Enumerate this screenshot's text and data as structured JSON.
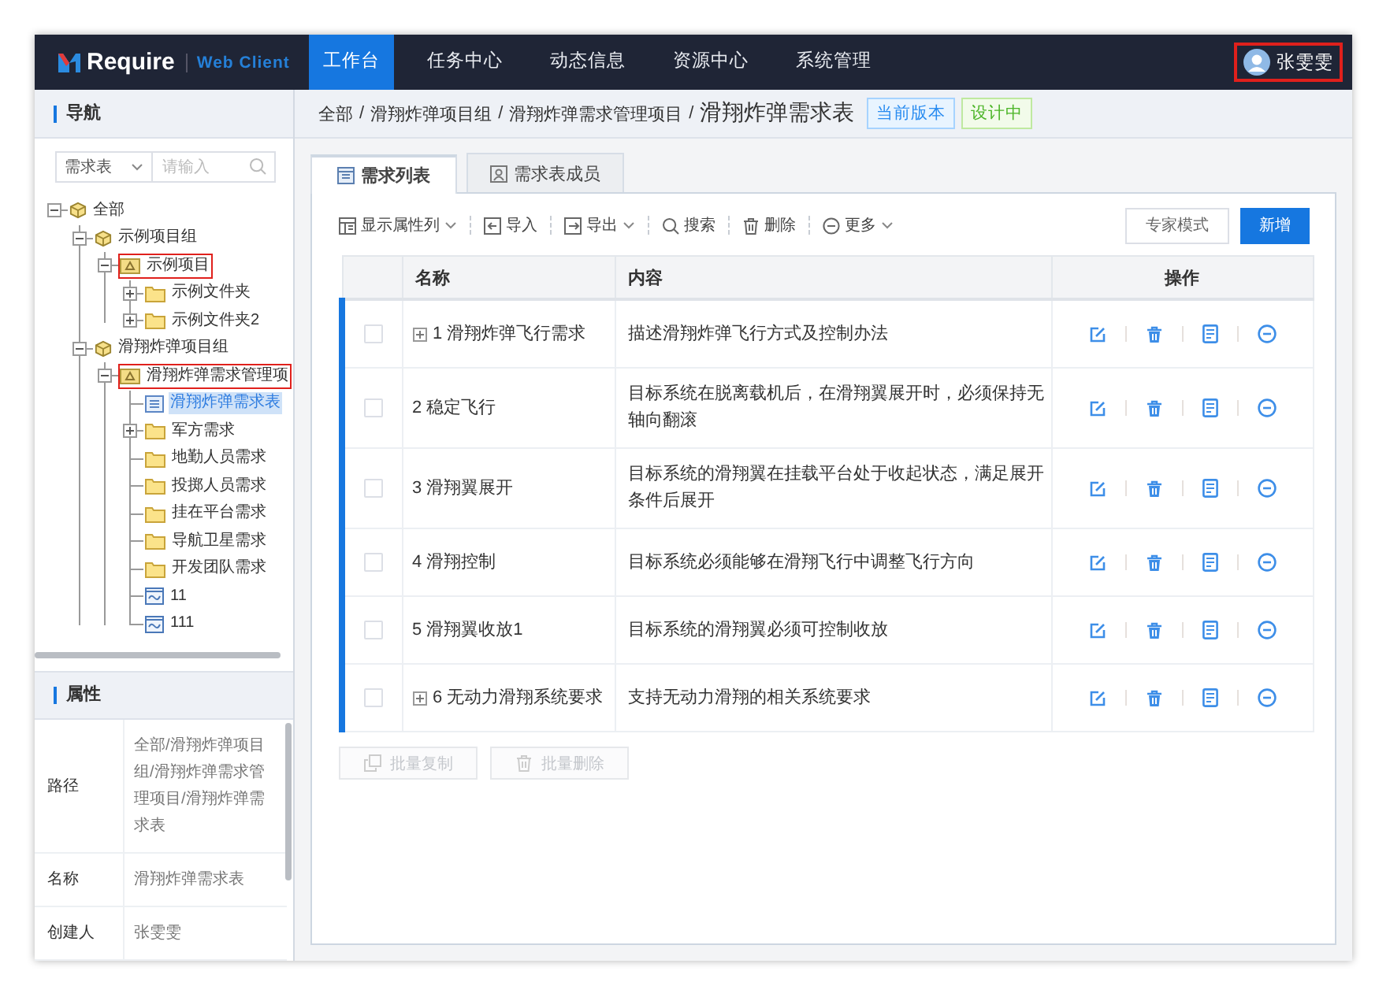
{
  "header": {
    "logo": {
      "brand": "Require",
      "subtitle": "Web Client"
    },
    "nav": [
      {
        "label": "工作台",
        "selected": true
      },
      {
        "label": "任务中心",
        "selected": false
      },
      {
        "label": "动态信息",
        "selected": false
      },
      {
        "label": "资源中心",
        "selected": false
      },
      {
        "label": "系统管理",
        "selected": false
      }
    ],
    "user": {
      "name": "张雯雯",
      "highlighted": true
    }
  },
  "sidebar": {
    "title": "导航",
    "filter": {
      "scope": "需求表",
      "placeholder": "请输入"
    },
    "tree": [
      {
        "label": "全部",
        "kind": "group",
        "expanded": true,
        "selected": false,
        "highlighted": false,
        "children": [
          {
            "label": "示例项目组",
            "kind": "group",
            "expanded": true,
            "selected": false,
            "highlighted": false,
            "children": [
              {
                "label": "示例项目",
                "kind": "project",
                "expanded": true,
                "selected": false,
                "highlighted": true,
                "children": [
                  {
                    "label": "示例文件夹",
                    "kind": "folder",
                    "expanded": false,
                    "selected": false,
                    "highlighted": false
                  },
                  {
                    "label": "示例文件夹2",
                    "kind": "folder",
                    "expanded": false,
                    "selected": false,
                    "highlighted": false
                  }
                ]
              }
            ]
          },
          {
            "label": "滑翔炸弹项目组",
            "kind": "group",
            "expanded": true,
            "selected": false,
            "highlighted": false,
            "children": [
              {
                "label": "滑翔炸弹需求管理项",
                "kind": "project",
                "expanded": true,
                "selected": false,
                "highlighted": true,
                "children": [
                  {
                    "label": "滑翔炸弹需求表",
                    "kind": "table",
                    "selected": true,
                    "highlighted": false
                  },
                  {
                    "label": "军方需求",
                    "kind": "folder",
                    "expanded": false,
                    "selected": false,
                    "highlighted": false
                  },
                  {
                    "label": "地勤人员需求",
                    "kind": "folder",
                    "selected": false,
                    "highlighted": false
                  },
                  {
                    "label": "投掷人员需求",
                    "kind": "folder",
                    "selected": false,
                    "highlighted": false
                  },
                  {
                    "label": "挂在平台需求",
                    "kind": "folder",
                    "selected": false,
                    "highlighted": false
                  },
                  {
                    "label": "导航卫星需求",
                    "kind": "folder",
                    "selected": false,
                    "highlighted": false
                  },
                  {
                    "label": "开发团队需求",
                    "kind": "folder",
                    "selected": false,
                    "highlighted": false
                  },
                  {
                    "label": "11",
                    "kind": "chart",
                    "selected": false,
                    "highlighted": false
                  },
                  {
                    "label": "111",
                    "kind": "chart",
                    "selected": false,
                    "highlighted": false
                  }
                ]
              }
            ]
          }
        ]
      }
    ],
    "properties": {
      "title": "属性",
      "rows": [
        {
          "label": "路径",
          "value": "全部/滑翔炸弹项目组/滑翔炸弹需求管理项目/滑翔炸弹需求表"
        },
        {
          "label": "名称",
          "value": "滑翔炸弹需求表"
        },
        {
          "label": "创建人",
          "value": "张雯雯"
        }
      ]
    }
  },
  "main": {
    "breadcrumb": {
      "separator": "/",
      "items": [
        "全部",
        "滑翔炸弹项目组",
        "滑翔炸弹需求管理项目"
      ],
      "current": "滑翔炸弹需求表"
    },
    "badges": [
      {
        "label": "当前版本",
        "kind": "version"
      },
      {
        "label": "设计中",
        "kind": "status"
      }
    ],
    "tabs": [
      {
        "label": "需求列表",
        "kind": "list",
        "selected": true
      },
      {
        "label": "需求表成员",
        "kind": "members",
        "selected": false
      }
    ],
    "toolbar": [
      {
        "label": "显示属性列",
        "kind": "columns",
        "dropdown": true
      },
      {
        "label": "导入",
        "kind": "import",
        "dropdown": false
      },
      {
        "label": "导出",
        "kind": "export",
        "dropdown": true
      },
      {
        "label": "搜索",
        "kind": "search",
        "dropdown": false
      },
      {
        "label": "删除",
        "kind": "delete",
        "dropdown": false
      },
      {
        "label": "更多",
        "kind": "more",
        "dropdown": true
      }
    ],
    "actions": [
      {
        "label": "专家模式",
        "kind": "default"
      },
      {
        "label": "新增",
        "kind": "primary"
      }
    ],
    "table": {
      "columns": [
        "名称",
        "内容",
        "操作"
      ],
      "rows": [
        {
          "name": "1 滑翔炸弹飞行需求",
          "content": "描述滑翔炸弹飞行方式及控制办法",
          "expandable": true,
          "checked": false
        },
        {
          "name": "2 稳定飞行",
          "content": "目标系统在脱离载机后，在滑翔翼展开时，必须保持无轴向翻滚",
          "expandable": false,
          "checked": false
        },
        {
          "name": "3 滑翔翼展开",
          "content": "目标系统的滑翔翼在挂载平台处于收起状态，满足展开条件后展开",
          "expandable": false,
          "checked": false
        },
        {
          "name": "4 滑翔控制",
          "content": "目标系统必须能够在滑翔飞行中调整飞行方向",
          "expandable": false,
          "checked": false
        },
        {
          "name": "5 滑翔翼收放1",
          "content": "目标系统的滑翔翼必须可控制收放",
          "expandable": false,
          "checked": false
        },
        {
          "name": "6 无动力滑翔系统要求",
          "content": "支持无动力滑翔的相关系统要求",
          "expandable": true,
          "checked": false
        }
      ]
    },
    "batch": [
      {
        "label": "批量复制",
        "kind": "copy",
        "disabled": true
      },
      {
        "label": "批量删除",
        "kind": "delete",
        "disabled": true
      }
    ]
  }
}
